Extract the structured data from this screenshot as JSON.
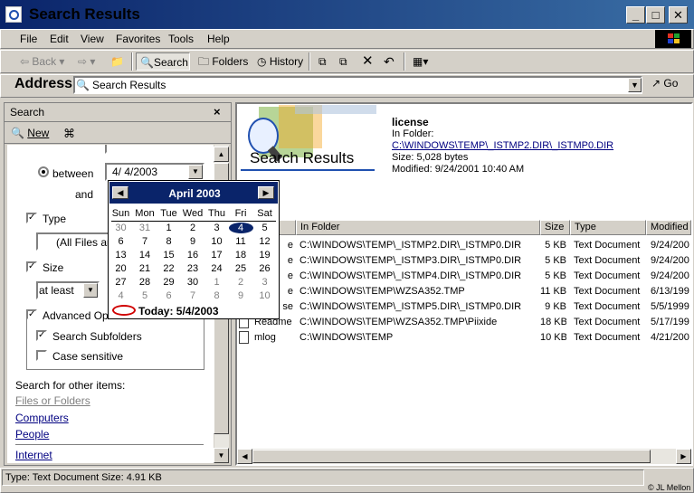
{
  "window": {
    "title": "Search Results"
  },
  "menu": [
    "File",
    "Edit",
    "View",
    "Favorites",
    "Tools",
    "Help"
  ],
  "toolbar": {
    "back": "Back",
    "search": "Search",
    "folders": "Folders",
    "history": "History"
  },
  "address": {
    "label": "Address",
    "value": "Search Results",
    "go": "Go"
  },
  "search_pane": {
    "header": "Search",
    "close": "×",
    "new_label": "New",
    "between_label": "between",
    "date_from": "4/  4/2003",
    "and_label": "and",
    "type_label": "Type",
    "type_value": "(All Files and",
    "size_label": "Size",
    "size_value": "at least",
    "advanced_label": "Advanced Options",
    "subfolders_label": "Search Subfolders",
    "case_label": "Case sensitive",
    "other_items": "Search for other items:",
    "links": [
      "Files or Folders",
      "Computers",
      "People",
      "Internet"
    ]
  },
  "calendar": {
    "title": "April 2003",
    "days_of_week": [
      "Sun",
      "Mon",
      "Tue",
      "Wed",
      "Thu",
      "Fri",
      "Sat"
    ],
    "weeks": [
      [
        "30",
        "31",
        "1",
        "2",
        "3",
        "4",
        "5"
      ],
      [
        "6",
        "7",
        "8",
        "9",
        "10",
        "11",
        "12"
      ],
      [
        "13",
        "14",
        "15",
        "16",
        "17",
        "18",
        "19"
      ],
      [
        "20",
        "21",
        "22",
        "23",
        "24",
        "25",
        "26"
      ],
      [
        "27",
        "28",
        "29",
        "30",
        "1",
        "2",
        "3"
      ],
      [
        "4",
        "5",
        "6",
        "7",
        "8",
        "9",
        "10"
      ]
    ],
    "selected": "4",
    "today": "Today: 5/4/2003"
  },
  "details": {
    "banner_title": "Search Results",
    "name": "license",
    "in_folder_label": "In Folder:",
    "folder": "C:\\WINDOWS\\TEMP\\_ISTMP2.DIR\\_ISTMP0.DIR",
    "size": "Size: 5,028 bytes",
    "modified": "Modified: 9/24/2001 10:40 AM"
  },
  "columns": [
    "In Folder",
    "Size",
    "Type",
    "Modified"
  ],
  "rows": [
    {
      "name": "e",
      "folder": "C:\\WINDOWS\\TEMP\\_ISTMP2.DIR\\_ISTMP0.DIR",
      "size": "5 KB",
      "type": "Text Document",
      "modified": "9/24/200"
    },
    {
      "name": "e",
      "folder": "C:\\WINDOWS\\TEMP\\_ISTMP3.DIR\\_ISTMP0.DIR",
      "size": "5 KB",
      "type": "Text Document",
      "modified": "9/24/200"
    },
    {
      "name": "e",
      "folder": "C:\\WINDOWS\\TEMP\\_ISTMP4.DIR\\_ISTMP0.DIR",
      "size": "5 KB",
      "type": "Text Document",
      "modified": "9/24/200"
    },
    {
      "name": "e",
      "folder": "C:\\WINDOWS\\TEMP\\WZSA352.TMP",
      "size": "11 KB",
      "type": "Text Document",
      "modified": "6/13/199"
    },
    {
      "name": "se",
      "folder": "C:\\WINDOWS\\TEMP\\_ISTMP5.DIR\\_ISTMP0.DIR",
      "size": "9 KB",
      "type": "Text Document",
      "modified": "5/5/1999"
    },
    {
      "name": "Readme",
      "folder": "C:\\WINDOWS\\TEMP\\WZSA352.TMP\\Piixide",
      "size": "18 KB",
      "type": "Text Document",
      "modified": "5/17/199"
    },
    {
      "name": "mlog",
      "folder": "C:\\WINDOWS\\TEMP",
      "size": "10 KB",
      "type": "Text Document",
      "modified": "4/21/200"
    }
  ],
  "status": {
    "text": "Type: Text Document Size: 4.91 KB",
    "copyright": "© JL Mellon"
  }
}
